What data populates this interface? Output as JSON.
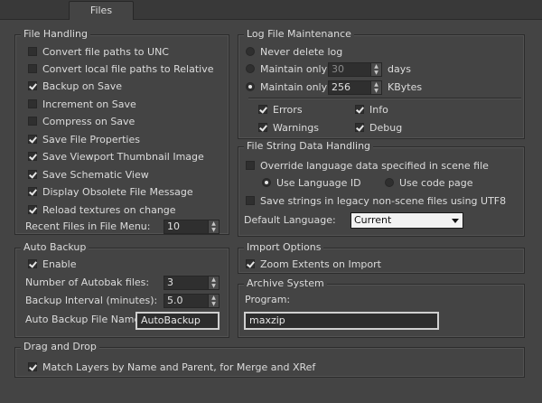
{
  "tabs": [
    {
      "label": "Files"
    }
  ],
  "file_handling": {
    "title": "File Handling",
    "options": [
      {
        "label": "Convert file paths to UNC",
        "checked": false
      },
      {
        "label": "Convert local file paths to Relative",
        "checked": false
      },
      {
        "label": "Backup on Save",
        "checked": true
      },
      {
        "label": "Increment on Save",
        "checked": false
      },
      {
        "label": "Compress on Save",
        "checked": false
      },
      {
        "label": "Save File Properties",
        "checked": true
      },
      {
        "label": "Save Viewport Thumbnail Image",
        "checked": true
      },
      {
        "label": "Save Schematic View",
        "checked": true
      },
      {
        "label": "Display Obsolete File Message",
        "checked": true
      },
      {
        "label": "Reload textures on change",
        "checked": true
      }
    ],
    "recent_files_label": "Recent Files in File Menu:",
    "recent_files_value": "10"
  },
  "auto_backup": {
    "title": "Auto Backup",
    "enable_label": "Enable",
    "enable_checked": true,
    "num_files_label": "Number of Autobak files:",
    "num_files_value": "3",
    "interval_label": "Backup Interval (minutes):",
    "interval_value": "5.0",
    "file_name_label": "Auto Backup File Name:",
    "file_name_value": "AutoBackup"
  },
  "drag_drop": {
    "title": "Drag and Drop",
    "match_layers_label": "Match Layers by Name and Parent, for Merge and XRef",
    "match_layers_checked": true
  },
  "log_file": {
    "title": "Log File Maintenance",
    "never_delete_label": "Never delete log",
    "maintain_days_label": "Maintain only",
    "maintain_days_value": "30",
    "days_unit": "days",
    "maintain_kb_label": "Maintain only",
    "maintain_kb_value": "256",
    "kb_unit": "KBytes",
    "selected_option": "maintain_kb",
    "levels": [
      {
        "label": "Errors",
        "checked": true
      },
      {
        "label": "Info",
        "checked": true
      },
      {
        "label": "Warnings",
        "checked": true
      },
      {
        "label": "Debug",
        "checked": true
      }
    ]
  },
  "string_data": {
    "title": "File String Data Handling",
    "override_label": "Override language data specified in scene file",
    "override_checked": false,
    "use_language_id_label": "Use Language ID",
    "use_code_page_label": "Use code page",
    "legacy_utf8_label": "Save strings in legacy non-scene files using UTF8",
    "legacy_utf8_checked": false,
    "default_language_label": "Default Language:",
    "default_language_value": "Current"
  },
  "import_options": {
    "title": "Import Options",
    "zoom_extents_label": "Zoom Extents on Import",
    "zoom_extents_checked": true
  },
  "archive": {
    "title": "Archive System",
    "program_label": "Program:",
    "program_value": "maxzip"
  }
}
